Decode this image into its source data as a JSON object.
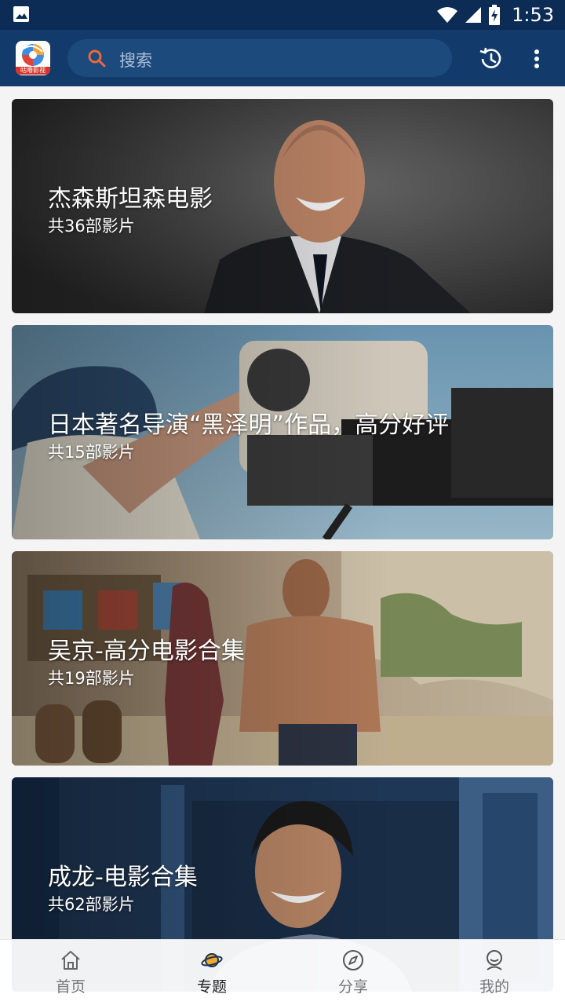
{
  "status_bar": {
    "time": "1:53",
    "icons": [
      "image-notification-icon",
      "wifi-icon",
      "signal-icon",
      "battery-charging-icon"
    ]
  },
  "app_bar": {
    "logo_text": "咕噜影视",
    "search_placeholder": "搜索",
    "actions": [
      "history-icon",
      "more-vert-icon"
    ]
  },
  "topics": [
    {
      "title": "杰森斯坦森电影",
      "count": "共36部影片"
    },
    {
      "title": "日本著名导演“黑泽明”作品，高分好评",
      "count": "共15部影片"
    },
    {
      "title": "吴京-高分电影合集",
      "count": "共19部影片"
    },
    {
      "title": "成龙-电影合集",
      "count": "共62部影片"
    }
  ],
  "bottom_nav": {
    "items": [
      {
        "label": "首页",
        "icon": "home-icon"
      },
      {
        "label": "专题",
        "icon": "planet-icon",
        "active": true
      },
      {
        "label": "分享",
        "icon": "compass-icon"
      },
      {
        "label": "我的",
        "icon": "profile-icon"
      }
    ]
  },
  "colors": {
    "status_bar": "#0c2c55",
    "app_bar": "#123a6a",
    "search_bg": "#1d4a7d",
    "search_icon": "#e8693a",
    "nav_active": "#222222",
    "nav_inactive": "#777777"
  }
}
